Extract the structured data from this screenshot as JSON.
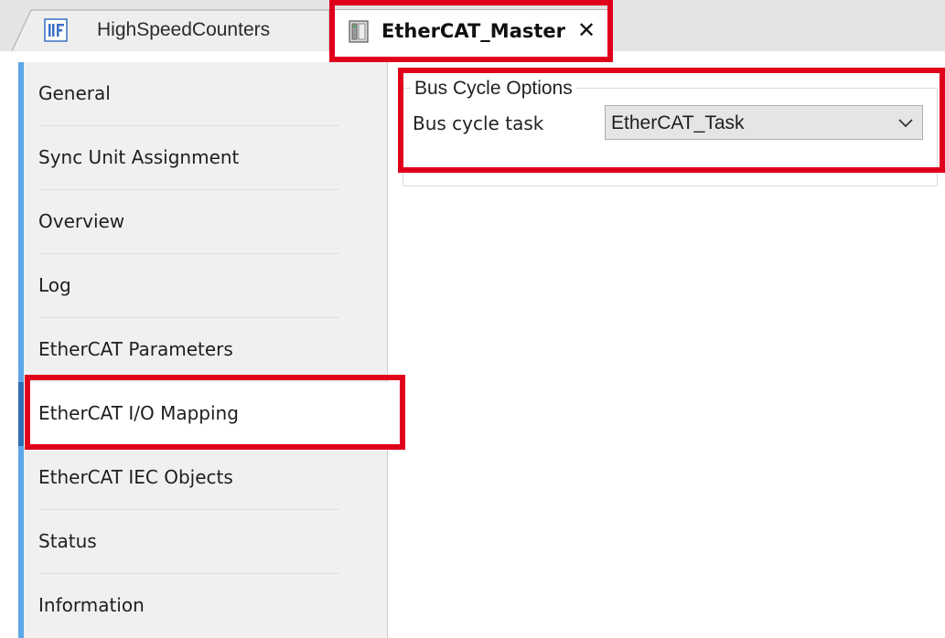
{
  "tabs": [
    {
      "label": "HighSpeedCounters",
      "icon": "io-module-icon",
      "active": false
    },
    {
      "label": "EtherCAT_Master",
      "icon": "device-master-icon",
      "active": true,
      "close_glyph": "✕"
    }
  ],
  "sidebar": {
    "items": [
      {
        "label": "General"
      },
      {
        "label": "Sync Unit Assignment"
      },
      {
        "label": "Overview"
      },
      {
        "label": "Log"
      },
      {
        "label": "EtherCAT Parameters"
      },
      {
        "label": "EtherCAT I/O Mapping",
        "selected": true
      },
      {
        "label": "EtherCAT IEC Objects"
      },
      {
        "label": "Status"
      },
      {
        "label": "Information"
      }
    ]
  },
  "main": {
    "group_title": "Bus Cycle Options",
    "bus_cycle_task_label": "Bus cycle task",
    "bus_cycle_task_value": "EtherCAT_Task"
  },
  "colors": {
    "highlight": "#e0001b",
    "nav_accent": "#5ea6e6",
    "nav_selected_bar": "#2f6db0",
    "nav_background": "#f0f0f0"
  }
}
